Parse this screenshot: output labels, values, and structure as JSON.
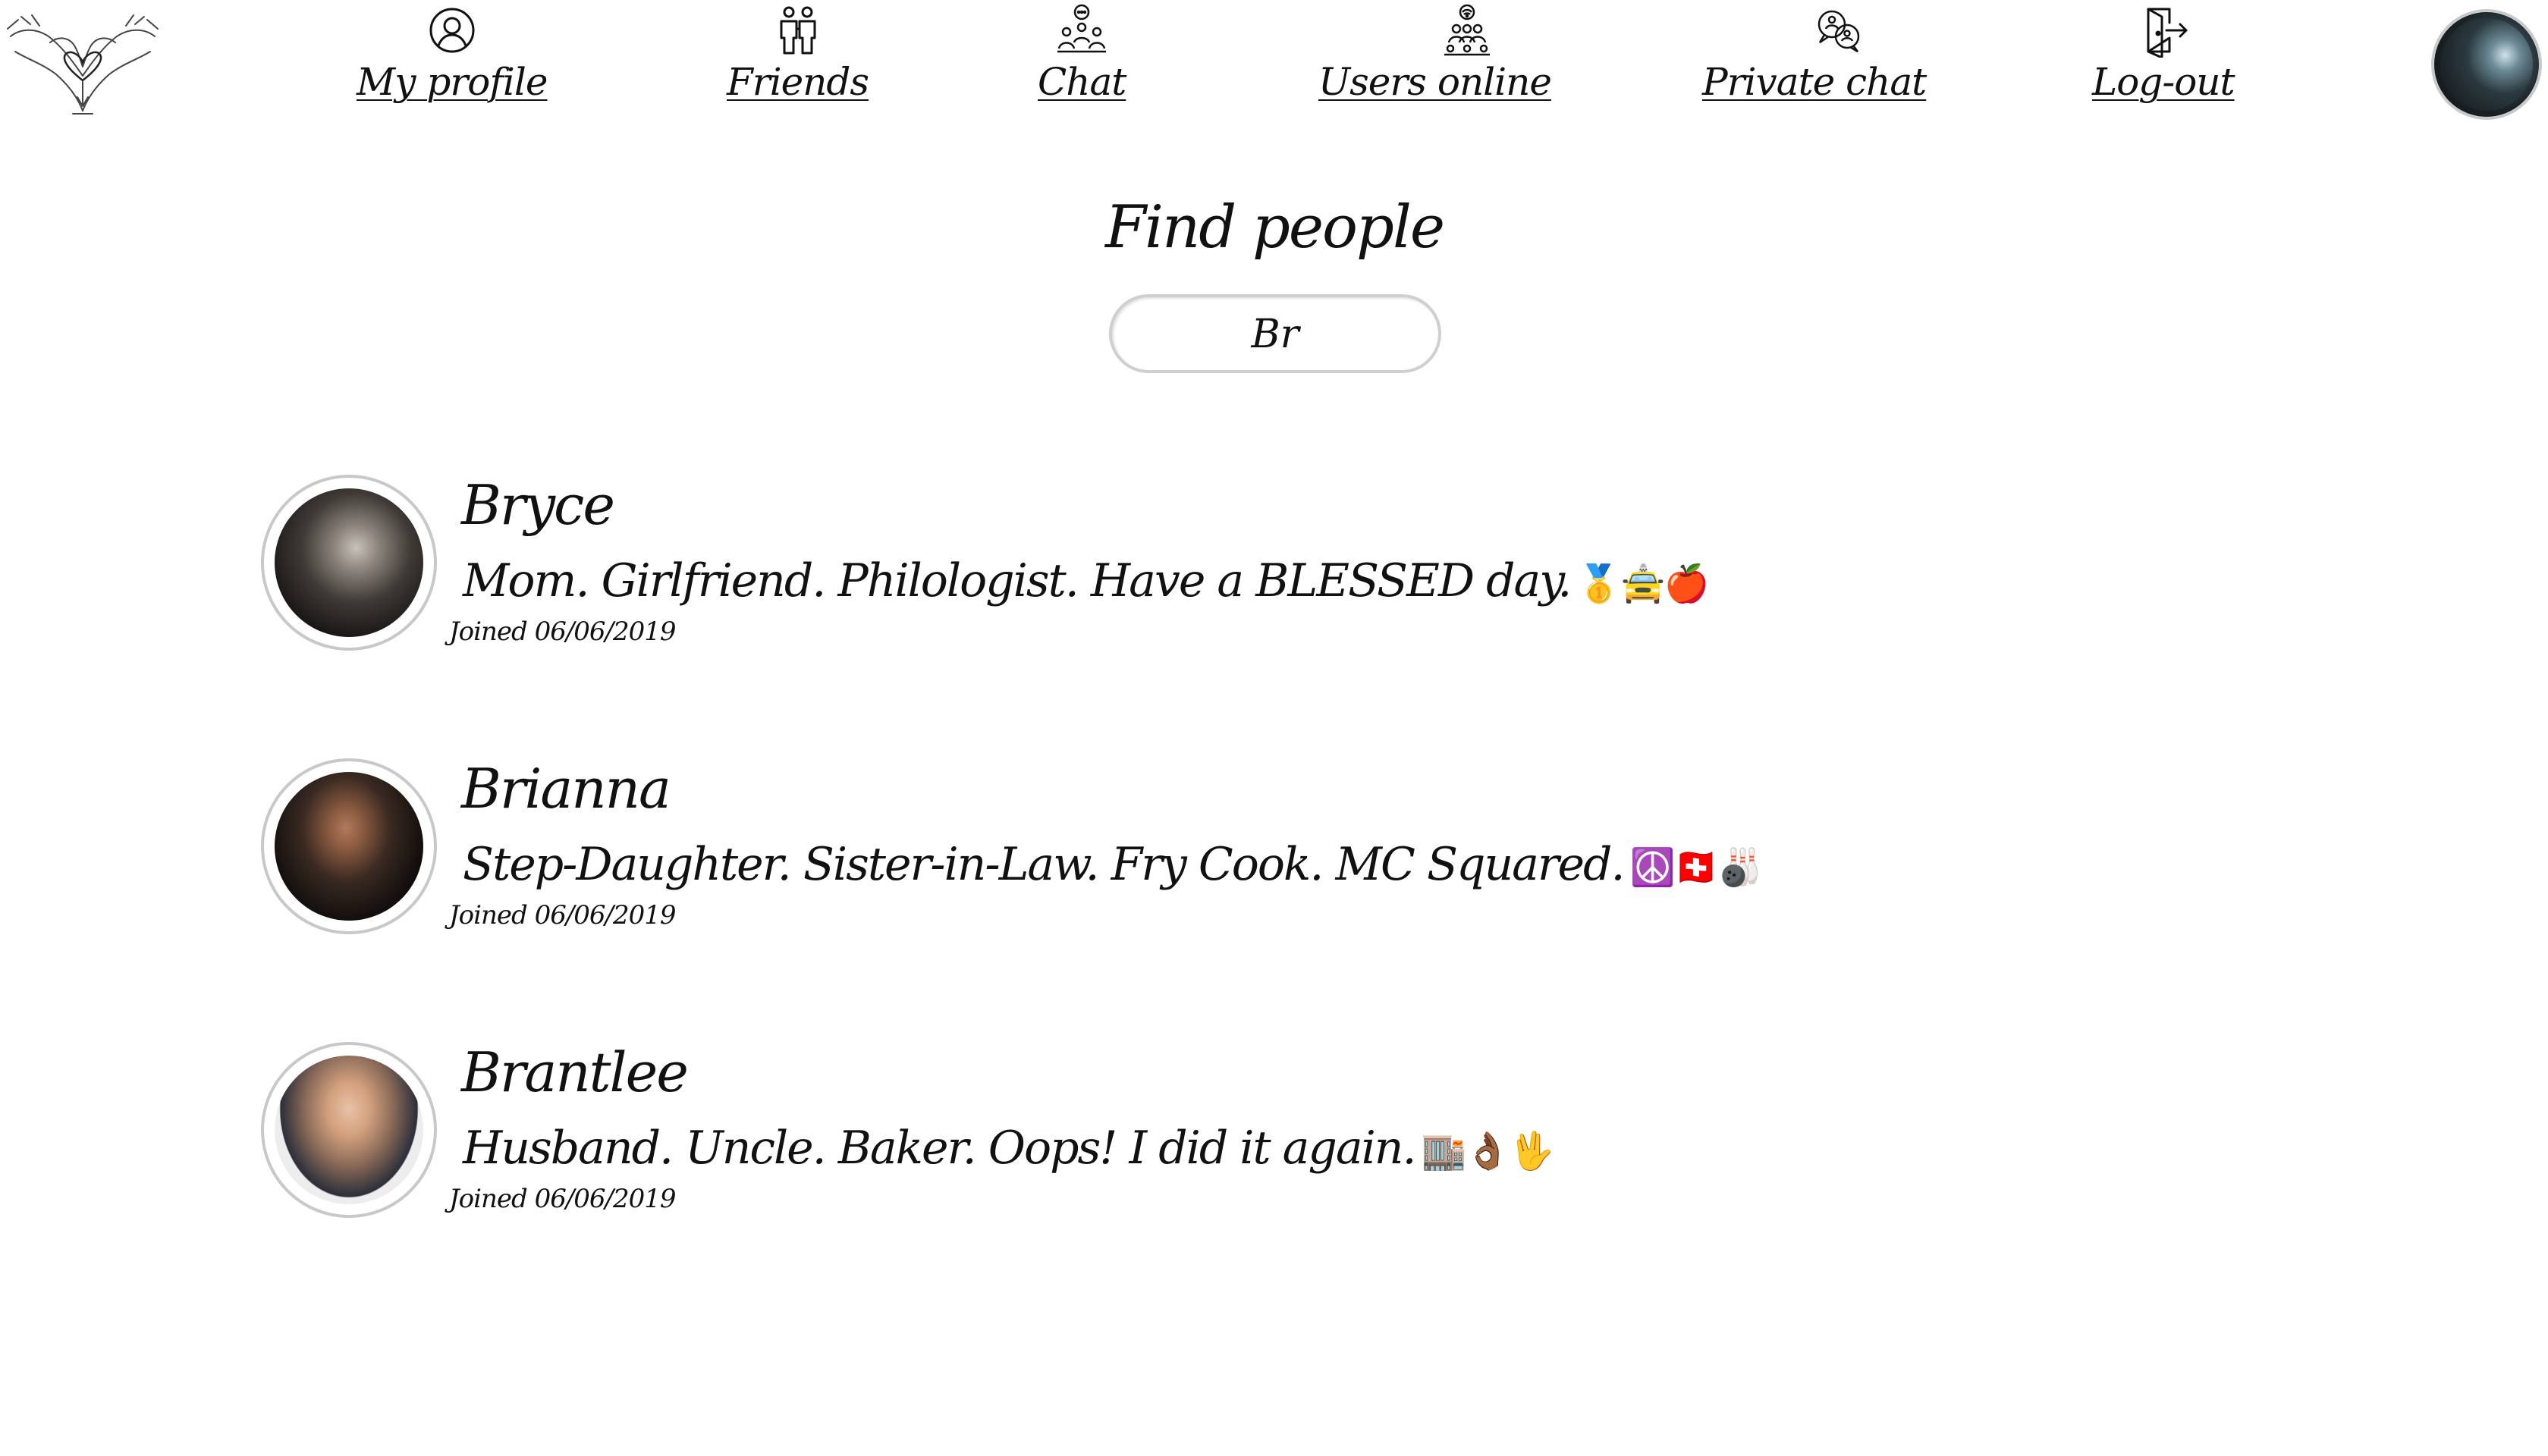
{
  "nav": {
    "items": [
      {
        "label": "My profile",
        "icon": "user-circle-icon"
      },
      {
        "label": "Friends",
        "icon": "friends-icon"
      },
      {
        "label": "Chat",
        "icon": "group-chat-icon"
      },
      {
        "label": "Users online",
        "icon": "users-online-icon"
      },
      {
        "label": "Private chat",
        "icon": "private-chat-icon"
      },
      {
        "label": "Log-out",
        "icon": "logout-door-icon"
      }
    ]
  },
  "search": {
    "title": "Find people",
    "value": "Br"
  },
  "results": [
    {
      "name": "Bryce",
      "bio": "Mom. Girlfriend. Philologist. Have a BLESSED day.",
      "emojis": "🥇🚖🍎",
      "joined": "Joined 06/06/2019"
    },
    {
      "name": "Brianna",
      "bio": "Step-Daughter. Sister-in-Law. Fry Cook. MC Squared.",
      "emojis": "☮️🇨🇭🎳",
      "joined": "Joined 06/06/2019"
    },
    {
      "name": "Brantlee",
      "bio": "Husband. Uncle. Baker. Oops! I did it again.",
      "emojis": "🏬👌🏾🖖",
      "joined": "Joined 06/06/2019"
    }
  ]
}
